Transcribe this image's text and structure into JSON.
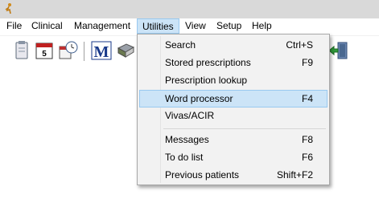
{
  "menubar": {
    "items": [
      {
        "label": "File"
      },
      {
        "label": "Clinical"
      },
      {
        "label": "Management"
      },
      {
        "label": "Utilities"
      },
      {
        "label": "View"
      },
      {
        "label": "Setup"
      },
      {
        "label": "Help"
      }
    ],
    "open_menu": "Utilities"
  },
  "toolbar": {
    "icons": [
      "clipboard-icon",
      "calendar-icon",
      "appointment-clock-icon",
      "mims-m-icon",
      "book-icon",
      "exit-door-icon"
    ],
    "calendar_day": "5",
    "mims_letter": "M"
  },
  "utilities_menu": {
    "groups": [
      [
        {
          "label": "Search",
          "shortcut": "Ctrl+S"
        },
        {
          "label": "Stored prescriptions",
          "shortcut": "F9"
        },
        {
          "label": "Prescription lookup",
          "shortcut": ""
        },
        {
          "label": "Word processor",
          "shortcut": "F4",
          "highlighted": true
        },
        {
          "label": "Vivas/ACIR",
          "shortcut": ""
        }
      ],
      [
        {
          "label": "Messages",
          "shortcut": "F8"
        },
        {
          "label": "To do list",
          "shortcut": "F6"
        },
        {
          "label": "Previous patients",
          "shortcut": "Shift+F2"
        }
      ]
    ]
  },
  "colors": {
    "titlebar": "#d9d9d9",
    "menu_highlight": "#cce4f7",
    "menu_highlight_border": "#99c9ef",
    "dropdown_bg": "#f2f2f2"
  }
}
